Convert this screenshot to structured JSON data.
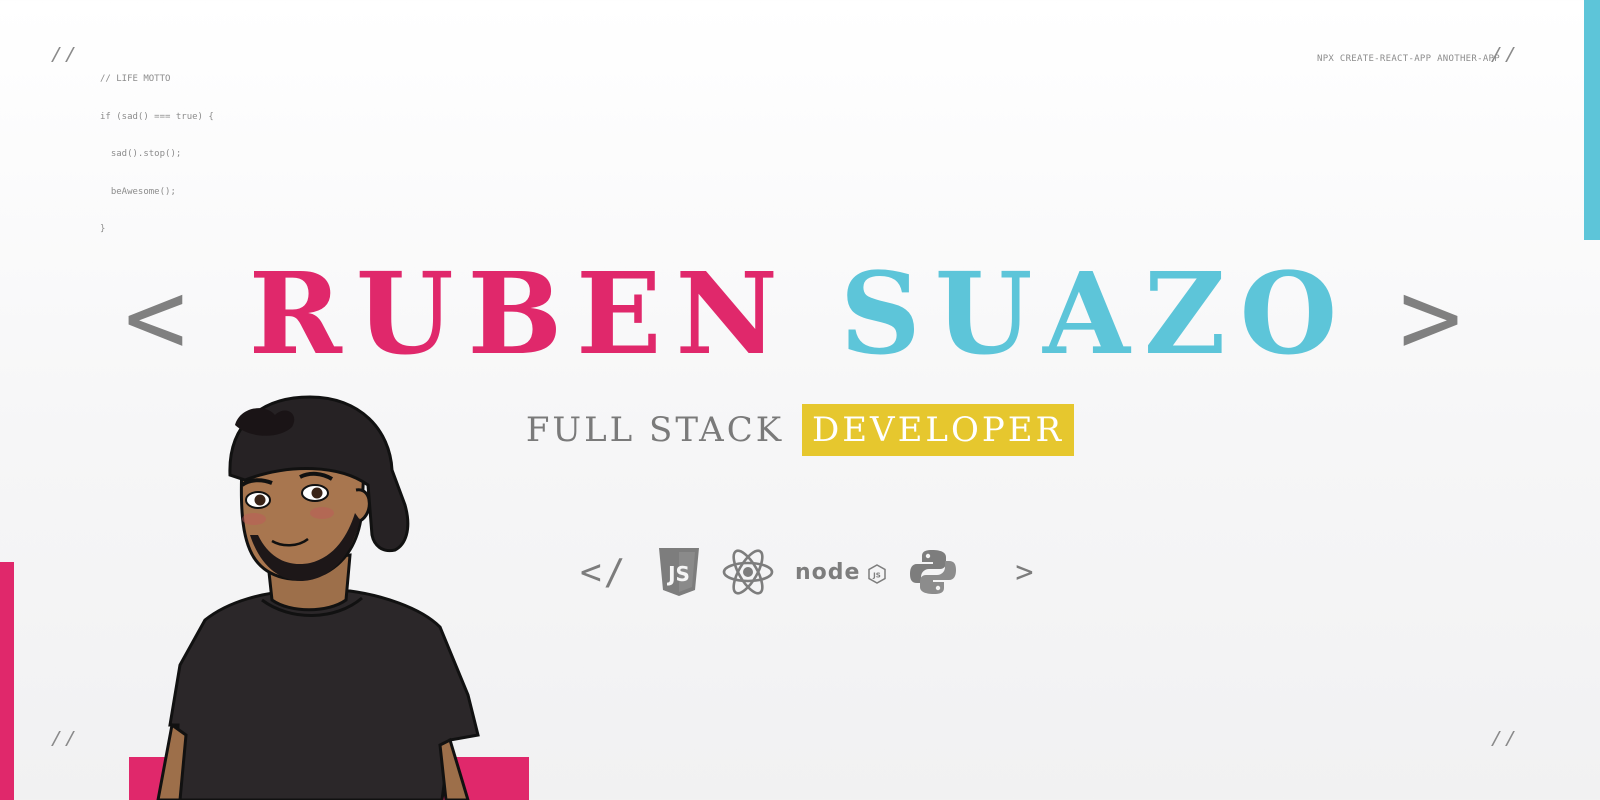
{
  "corners": {
    "marker": "//"
  },
  "motto": {
    "lines": [
      "// LIFE MOTTO",
      "if (sad() === true) {",
      "  sad().stop();",
      "  beAwesome();",
      "}"
    ]
  },
  "npx_text": "NPX CREATE-REACT-APP ANOTHER-APP",
  "hero": {
    "open_bracket": "<",
    "first_name": "RUBEN",
    "last_name": "SUAZO",
    "close_bracket": ">"
  },
  "subtitle": {
    "plain": "FULL STACK",
    "highlight": "DEVELOPER"
  },
  "stack": {
    "open_tag": "</",
    "close_tag": ">",
    "icons": [
      "javascript-icon",
      "react-icon",
      "nodejs-icon",
      "python-icon"
    ],
    "nodejs_label": "node",
    "nodejs_badge": "JS"
  },
  "colors": {
    "pink": "#e0286b",
    "cyan": "#5dc5d9",
    "yellow": "#e6c72e",
    "gray": "#808080"
  }
}
